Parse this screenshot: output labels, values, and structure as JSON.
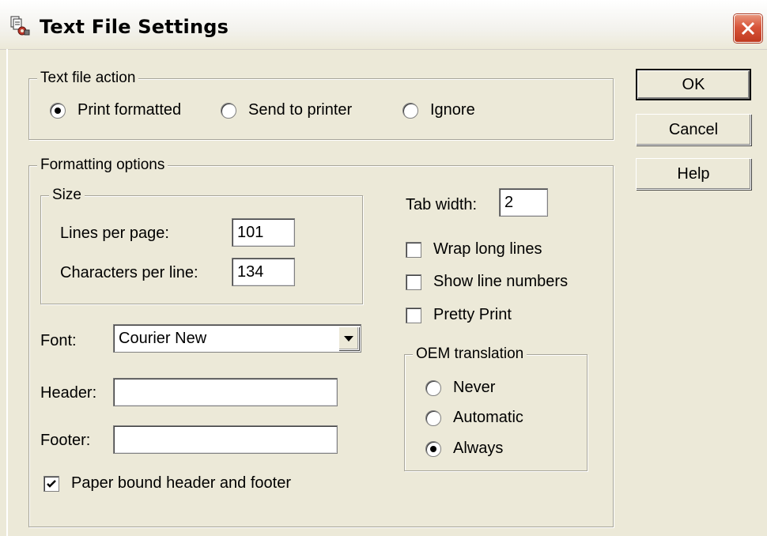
{
  "window": {
    "title": "Text File Settings",
    "icon": "text-settings-icon",
    "close_icon": "close-icon"
  },
  "text_file_action": {
    "legend": "Text file action",
    "options": [
      {
        "label": "Print formatted",
        "selected": true
      },
      {
        "label": "Send to printer",
        "selected": false
      },
      {
        "label": "Ignore",
        "selected": false
      }
    ]
  },
  "formatting_options": {
    "legend": "Formatting options",
    "size": {
      "legend": "Size",
      "lines_per_page_label": "Lines per page:",
      "lines_per_page_value": "101",
      "chars_per_line_label": "Characters per line:",
      "chars_per_line_value": "134"
    },
    "font_label": "Font:",
    "font_value": "Courier New",
    "header_label": "Header:",
    "header_value": "",
    "footer_label": "Footer:",
    "footer_value": "",
    "paper_bound": {
      "label": "Paper bound header and footer",
      "checked": true
    },
    "tab_width_label": "Tab width:",
    "tab_width_value": "2",
    "wrap_long_lines": {
      "label": "Wrap long lines",
      "checked": false
    },
    "show_line_numbers": {
      "label": "Show line numbers",
      "checked": false
    },
    "pretty_print": {
      "label": "Pretty Print",
      "checked": false
    },
    "oem_translation": {
      "legend": "OEM translation",
      "options": [
        {
          "label": "Never",
          "selected": false
        },
        {
          "label": "Automatic",
          "selected": false
        },
        {
          "label": "Always",
          "selected": true
        }
      ]
    }
  },
  "buttons": {
    "ok": "OK",
    "cancel": "Cancel",
    "help": "Help"
  }
}
